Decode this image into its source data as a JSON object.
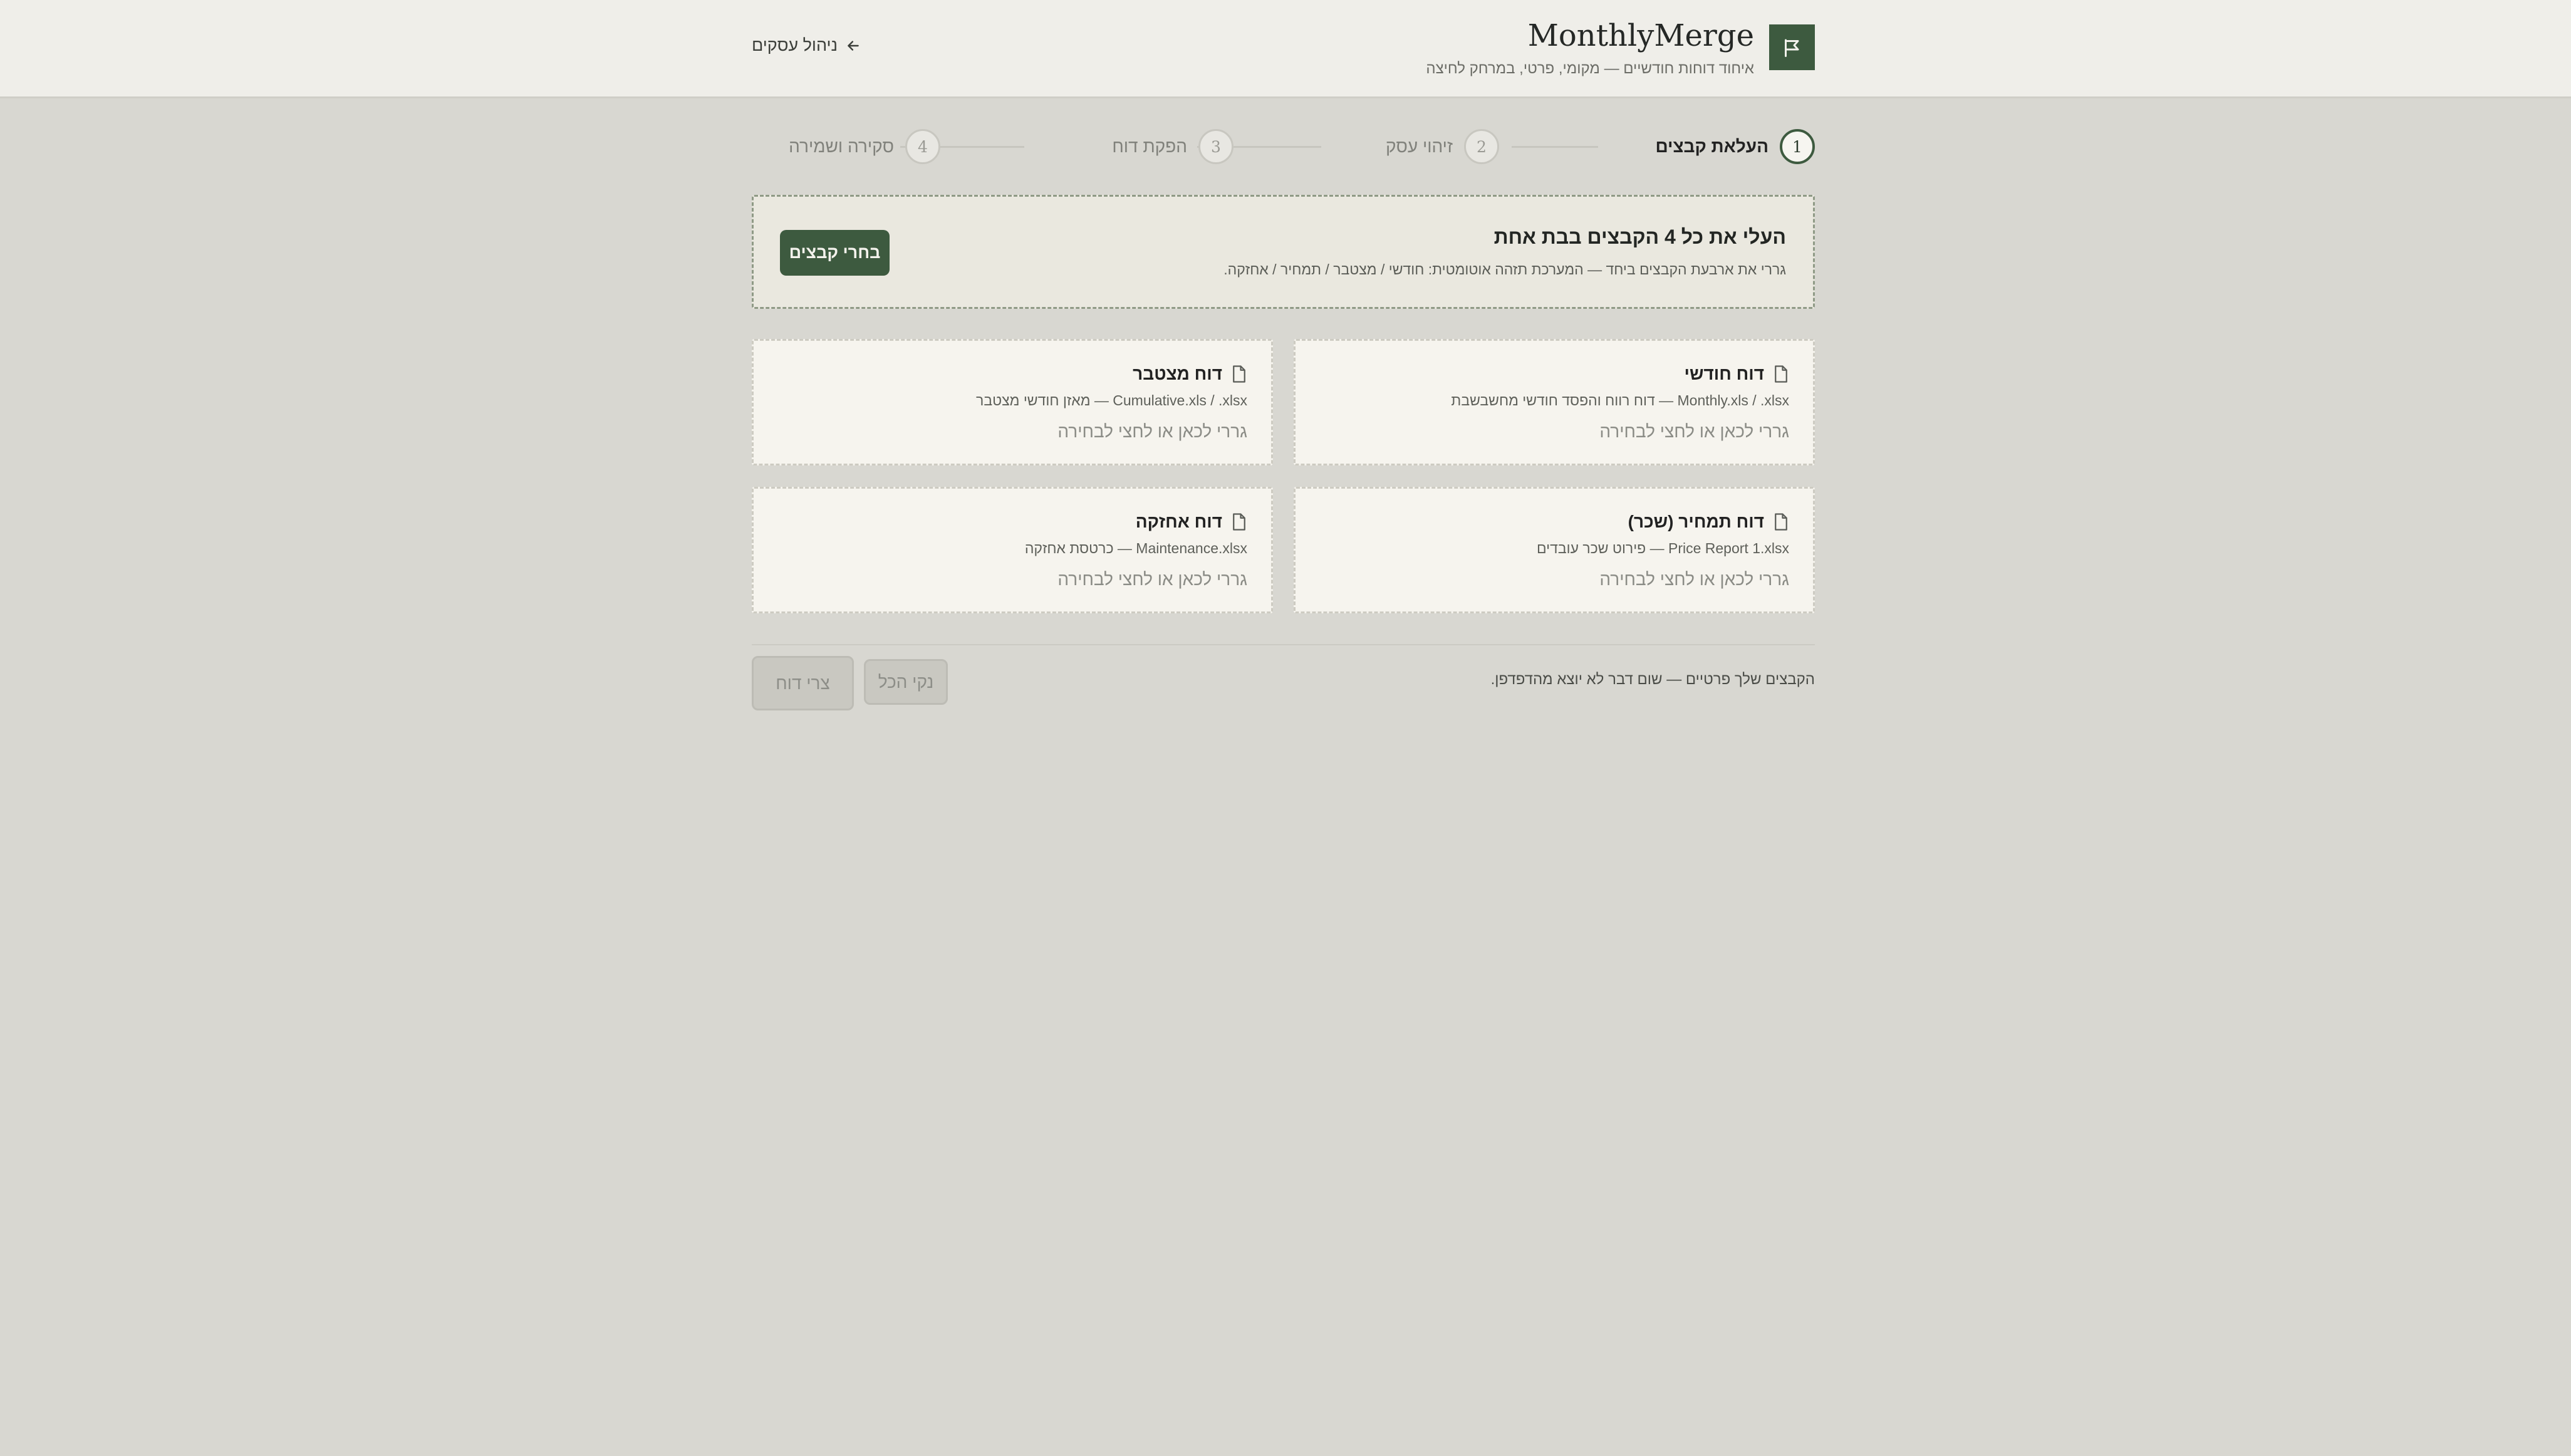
{
  "header": {
    "brand_title": "MonthlyMerge",
    "brand_subtitle": "איחוד דוחות חודשיים — מקומי, פרטי, במרחק לחיצה",
    "back_label": "ניהול עסקים",
    "logo_icon": "flag-icon",
    "accent_color": "#3d5a3f"
  },
  "stepper": {
    "steps": [
      {
        "number": "1",
        "label": "העלאת קבצים",
        "active": true
      },
      {
        "number": "2",
        "label": "זיהוי עסק",
        "active": false
      },
      {
        "number": "3",
        "label": "הפקת דוח",
        "active": false
      },
      {
        "number": "4",
        "label": "סקירה ושמירה",
        "active": false
      }
    ]
  },
  "bulk": {
    "title": "העלי את כל 4 הקבצים בבת אחת",
    "description": "גררי את ארבעת הקבצים ביחד — המערכת תזהה אוטומטית: חודשי / מצטבר / תמחיר / אחזקה.",
    "button_label": "בחרי קבצים"
  },
  "cards": [
    {
      "title": "דוח חודשי",
      "file": "Monthly.xls / .xlsx — דוח רווח והפסד חודשי מחשבשבת",
      "hint": "גררי לכאן או לחצי לבחירה",
      "icon": "file-icon"
    },
    {
      "title": "דוח מצטבר",
      "file": "Cumulative.xls / .xlsx — מאזן חודשי מצטבר",
      "hint": "גררי לכאן או לחצי לבחירה",
      "icon": "file-icon"
    },
    {
      "title": "דוח תמחיר (שכר)",
      "file": "Price Report 1.xlsx — פירוט שכר עובדים",
      "hint": "גררי לכאן או לחצי לבחירה",
      "icon": "file-icon"
    },
    {
      "title": "דוח אחזקה",
      "file": "Maintenance.xlsx — כרטסת אחזקה",
      "hint": "גררי לכאן או לחצי לבחירה",
      "icon": "file-icon"
    }
  ],
  "footer": {
    "privacy_note": "הקבצים שלך פרטיים — שום דבר לא יוצא מהדפדפן.",
    "clear_label": "נקי הכל",
    "create_label": "צרי דוח"
  }
}
